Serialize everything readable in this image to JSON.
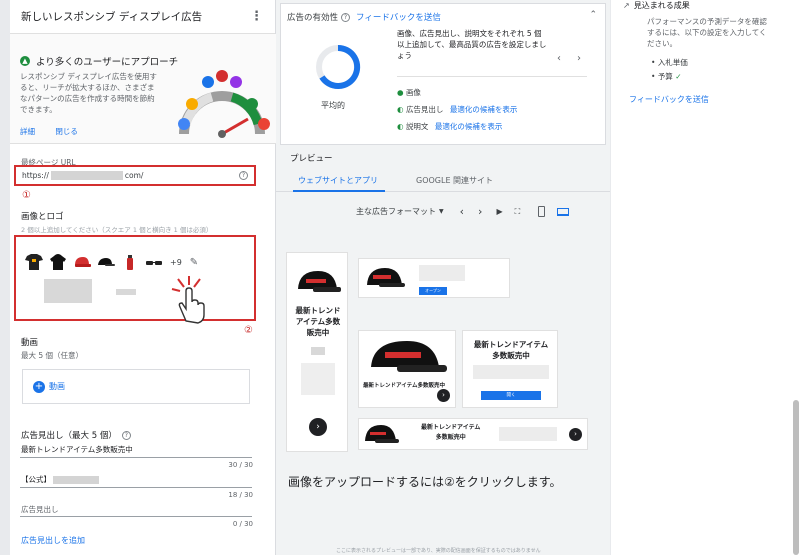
{
  "left": {
    "title": "新しいレスポンシブ ディスプレイ広告",
    "promo": {
      "heading": "より多くのユーザーにアプローチ",
      "body_lines": [
        "レスポンシブ ディスプレイ広告を使用す",
        "ると、リーチが拡大するほか、さまざま",
        "なパターンの広告を作成する時間を節約",
        "できます。"
      ],
      "link_detail": "詳細",
      "link_close": "閉じる"
    },
    "url_label": "最終ページ URL",
    "url_prefix": "https://",
    "url_suffix": "com/",
    "marker1": "①",
    "images_title": "画像とロゴ",
    "images_hint": "2 個以上追加してください（スクエア 1 個と横向き 1 個は必須）",
    "more_count": "+9",
    "marker2": "②",
    "video_title": "動画",
    "video_hint": "最大 5 個（任意）",
    "video_add": "動画",
    "headlines_title": "広告見出し（最大 5 個）",
    "headline1": "最新トレンドアイテム多数販売中",
    "headline1_count": "30 / 30",
    "headline2_prefix": "【公式】",
    "headline2_count": "18 / 30",
    "headline3_placeholder": "広告見出し",
    "headline3_count": "0 / 30",
    "add_headline": "広告見出しを追加"
  },
  "effect": {
    "title": "広告の有効性",
    "feedback": "フィードバックを送信",
    "rating": "平均的",
    "suggestion_lines": [
      "画像、広告見出し、説明文をそれぞれ 5 個",
      "以上追加して、最高品質の広告を設定しまし",
      "ょう"
    ],
    "rows": [
      {
        "label": "画像",
        "link": ""
      },
      {
        "label": "広告見出し",
        "link": "最適化の候補を表示"
      },
      {
        "label": "説明文",
        "link": "最適化の候補を表示"
      }
    ]
  },
  "preview": {
    "title": "プレビュー",
    "tab_web": "ウェブサイトとアプリ",
    "tab_google": "GOOGLE 関連サイト",
    "format": "主な広告フォーマット",
    "ad_headline_lines": [
      "最新トレンド",
      "アイテム多数",
      "販売中"
    ],
    "ad_headline_wide": "最新トレンドアイテム多数販売中",
    "ad_headline_two_lines": [
      "最新トレンドアイテム",
      "多数販売中"
    ],
    "ad_button": "オープン",
    "ad_button2": "開く",
    "caption": "画像をアップロードするには②をクリックします。",
    "footer": "ここに表示されるプレビューは一部であり、実際の配信画面を保証するものではありません"
  },
  "right": {
    "section_title": "見込まれる成果",
    "body_lines": [
      "パフォーマンスの予測データを確認",
      "するには、以下の設定を入力してく",
      "ださい。"
    ],
    "items": [
      "入札単価",
      "予算"
    ],
    "feedback": "フィードバックを送信"
  },
  "colors": {
    "accent": "#1a73e8",
    "warn": "#d32f2f",
    "ok": "#1e8e3e"
  }
}
